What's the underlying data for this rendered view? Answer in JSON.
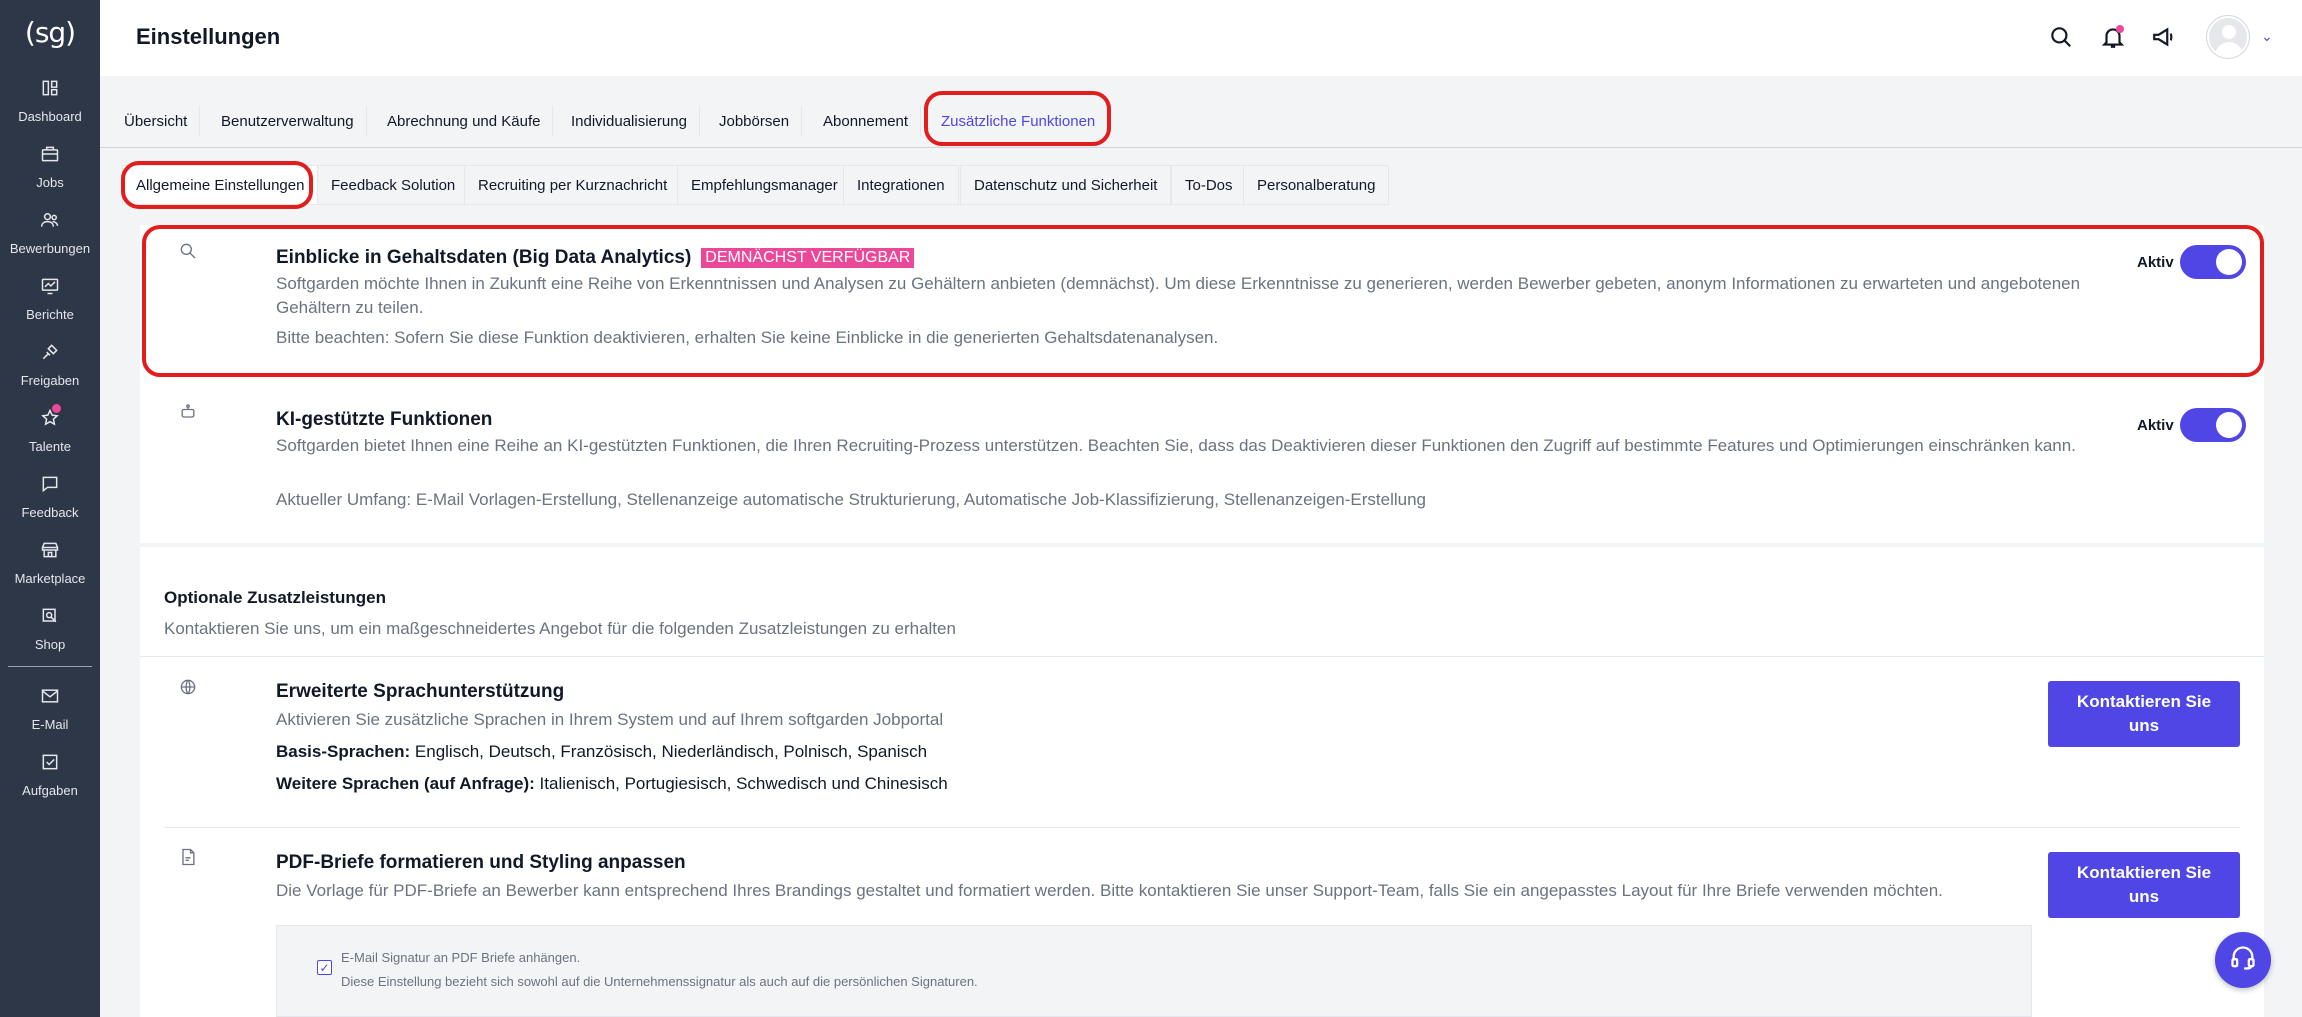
{
  "sidebar": {
    "logo": "(sg)",
    "items": [
      {
        "label": "Dashboard",
        "icon": "dashboard-icon"
      },
      {
        "label": "Jobs",
        "icon": "briefcase-icon"
      },
      {
        "label": "Bewerbungen",
        "icon": "users-icon"
      },
      {
        "label": "Berichte",
        "icon": "chart-icon"
      },
      {
        "label": "Freigaben",
        "icon": "approval-icon"
      },
      {
        "label": "Talente",
        "icon": "star-icon"
      },
      {
        "label": "Feedback",
        "icon": "feedback-icon"
      },
      {
        "label": "Marketplace",
        "icon": "store-icon"
      },
      {
        "label": "Shop",
        "icon": "shop-icon"
      },
      {
        "label": "E-Mail",
        "icon": "mail-icon"
      },
      {
        "label": "Aufgaben",
        "icon": "tasks-icon"
      }
    ]
  },
  "header": {
    "title": "Einstellungen"
  },
  "main_tabs": [
    {
      "label": "Übersicht"
    },
    {
      "label": "Benutzerverwaltung"
    },
    {
      "label": "Abrechnung und Käufe"
    },
    {
      "label": "Individualisierung"
    },
    {
      "label": "Jobbörsen"
    },
    {
      "label": "Abonnement"
    },
    {
      "label": "Zusätzliche Funktionen"
    }
  ],
  "sub_tabs": [
    {
      "label": "Allgemeine Einstellungen"
    },
    {
      "label": "Feedback Solution"
    },
    {
      "label": "Recruiting per Kurznachricht"
    },
    {
      "label": "Empfehlungsmanager"
    },
    {
      "label": "Integrationen"
    },
    {
      "label": "Datenschutz und Sicherheit"
    },
    {
      "label": "To-Dos"
    },
    {
      "label": "Personalberatung"
    }
  ],
  "features": [
    {
      "title": "Einblicke in Gehaltsdaten (Big Data Analytics)",
      "badge": "DEMNÄCHST VERFÜGBAR",
      "description": "Softgarden möchte Ihnen in Zukunft eine Reihe von Erkenntnissen und Analysen zu Gehältern anbieten (demnächst). Um diese Erkenntnisse zu generieren, werden Bewerber gebeten, anonym Informationen zu erwarteten und angebotenen Gehältern zu teilen.",
      "note": "Bitte beachten: Sofern Sie diese Funktion deaktivieren, erhalten Sie keine Einblicke in die generierten Gehaltsdatenanalysen.",
      "toggle_label": "Aktiv",
      "enabled": true
    },
    {
      "title": "KI-gestützte Funktionen",
      "description": "Softgarden bietet Ihnen eine Reihe an KI-gestützten Funktionen, die Ihren Recruiting-Prozess unterstützen. Beachten Sie, dass das Deaktivieren dieser Funktionen den Zugriff auf bestimmte Features und Optimierungen einschränken kann.",
      "note": "Aktueller Umfang: E-Mail Vorlagen-Erstellung, Stellenanzeige automatische Strukturierung, Automatische Job-Klassifizierung, Stellenanzeigen-Erstellung",
      "toggle_label": "Aktiv",
      "enabled": true
    }
  ],
  "optional": {
    "heading": "Optionale Zusatzleistungen",
    "subheading": "Kontaktieren Sie uns, um ein maßgeschneidertes Angebot für die folgenden Zusatzleistungen zu erhalten",
    "services": [
      {
        "title": "Erweiterte Sprachunterstützung",
        "description": "Aktivieren Sie zusätzliche Sprachen in Ihrem System und auf Ihrem softgarden Jobportal",
        "line1_label": "Basis-Sprachen:",
        "line1_value": " Englisch, Deutsch, Französisch, Niederländisch, Polnisch, Spanisch",
        "line2_label": "Weitere Sprachen (auf Anfrage):",
        "line2_value": " Italienisch, Portugiesisch, Schwedisch und Chinesisch",
        "button": "Kontaktieren Sie uns"
      },
      {
        "title": "PDF-Briefe formatieren und Styling anpassen",
        "description": "Die Vorlage für PDF-Briefe an Bewerber kann entsprechend Ihres Brandings gestaltet und formatiert werden. Bitte kontaktieren Sie unser Support-Team, falls Sie ein angepasstes Layout für Ihre Briefe verwenden möchten.",
        "button": "Kontaktieren Sie uns",
        "checkbox_label": "E-Mail Signatur an PDF Briefe anhängen.",
        "checkbox_note": "Diese Einstellung bezieht sich sowohl auf die Unternehmenssignatur als auch auf die persönlichen Signaturen.",
        "checkbox_checked": true
      }
    ]
  },
  "colors": {
    "accent": "#4f46e5",
    "badge": "#ec4899",
    "sidebar": "#2d3748",
    "annotation": "#e11d1d"
  }
}
